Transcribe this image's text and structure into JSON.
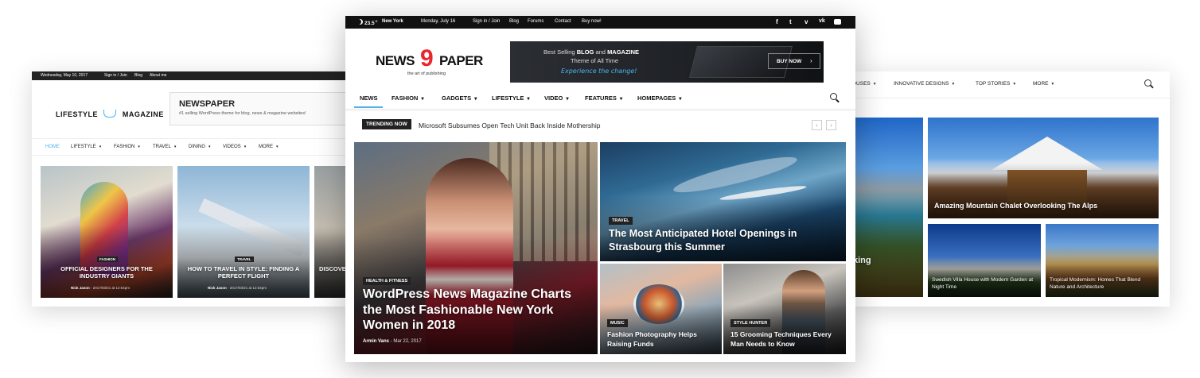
{
  "left": {
    "topbar": {
      "date": "Wednesday, May 10, 2017",
      "links": [
        "Sign in / Join",
        "Blog",
        "About me"
      ]
    },
    "logo": {
      "word1": "LIFESTYLE",
      "word2": "MAGAZINE",
      "cup_icon": "coffee-cup-icon"
    },
    "ad": {
      "title": "NEWSPAPER",
      "subtitle": "#1 selling WordPress theme for blog, news & magazine websites!"
    },
    "nav": [
      "HOME",
      "LIFESTYLE",
      "FASHION",
      "TRAVEL",
      "DINING",
      "VIDEOS",
      "MORE"
    ],
    "cards": [
      {
        "category": "FASHION",
        "title": "OFFICIAL DESIGNERS FOR THE INDUSTRY GIANTS",
        "author": "Nick Jason",
        "date": "2017/03/21 at 12:54pm"
      },
      {
        "category": "TRAVEL",
        "title": "HOW TO TRAVEL IN STYLE: FINDING A PERFECT FLIGHT",
        "author": "Nick Jason",
        "date": "2017/03/21 at 12:54pm"
      },
      {
        "category": "",
        "title": "DISCOVE",
        "author": "",
        "date": ""
      }
    ]
  },
  "right": {
    "nav": [
      "OUSES",
      "INNOVATIVE DESIGNS",
      "TOP STORIES",
      "MORE"
    ],
    "cards": [
      {
        "title": "king"
      },
      {
        "title": "Amazing Mountain Chalet Overlooking The Alps"
      },
      {
        "title": "Swedish Villa House with Modern Garden at Night Time"
      },
      {
        "title": "Tropical Modernism: Homes That Blend Nature and Architecture"
      }
    ]
  },
  "center": {
    "topbar": {
      "temp": "23.5",
      "deg": "C",
      "city": "New York",
      "date": "Monday, July 16",
      "links": [
        "Sign in / Join",
        "Blog",
        "Forums",
        "Contact",
        "Buy now!"
      ],
      "social": [
        "f",
        "t",
        "v",
        "vk",
        "yt"
      ]
    },
    "logo": {
      "left": "NEWS",
      "num": "9",
      "right": "PAPER",
      "tagline": "the art of publishing"
    },
    "banner": {
      "line1a": "Best Selling ",
      "line1b": "BLOG",
      "line1c": " and ",
      "line1d": "MAGAZINE",
      "line2": "Theme of All Time",
      "line3": "Experience the change!",
      "button": "BUY NOW"
    },
    "nav": [
      "NEWS",
      "FASHION",
      "GADGETS",
      "LIFESTYLE",
      "VIDEO",
      "FEATURES",
      "HOMEPAGES"
    ],
    "trending": {
      "label": "TRENDING NOW",
      "text": "Microsoft Subsumes Open Tech Unit Back Inside Mothership"
    },
    "main": {
      "category": "HEALTH & FITNESS",
      "title": "WordPress News Magazine Charts the Most Fashionable New York Women in 2018",
      "author": "Armin Vans",
      "date": "Mar 22, 2017"
    },
    "tr": {
      "category": "TRAVEL",
      "title": "The Most Anticipated Hotel Openings in Strasbourg this Summer"
    },
    "bl": {
      "category": "MUSIC",
      "title": "Fashion Photography Helps Raising Funds"
    },
    "br": {
      "category": "STYLE HUNTER",
      "title": "15 Grooming Techniques Every Man Needs to Know"
    }
  },
  "colors": {
    "accent": "#4db2ec",
    "dark": "#222222",
    "logo_red": "#e8262b"
  }
}
